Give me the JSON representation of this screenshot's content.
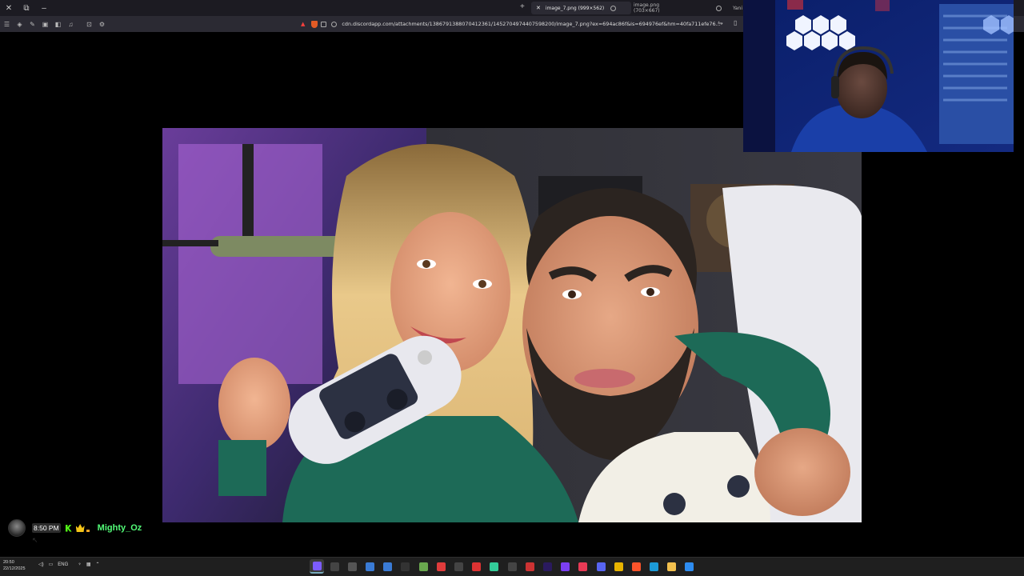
{
  "browser": {
    "tabs": [
      {
        "label": "image_7.png (999×562)",
        "active": true
      },
      {
        "label": "image.png (703×667)",
        "active": false
      },
      {
        "label": "Yani",
        "active": false
      }
    ],
    "url": "cdn.discordapp.com/attachments/1386791388070412361/1452704974407598200/image_7.png?ex=694ac86f&is=694976ef&hm=40fa711efe76..."
  },
  "chat": {
    "time": "8:50 PM",
    "username": "Mighty_Oz"
  },
  "taskbar": {
    "clock_time": "20:50",
    "clock_date": "22/12/2025",
    "language": "ENG",
    "apps": [
      {
        "name": "browser-pen-app",
        "color": "#7c5cff",
        "active": true
      },
      {
        "name": "audio-app",
        "color": "#444"
      },
      {
        "name": "obs-app",
        "color": "#555"
      },
      {
        "name": "arrow-app",
        "color": "#3a7bd5"
      },
      {
        "name": "arrow2-app",
        "color": "#3a7bd5"
      },
      {
        "name": "steam-app",
        "color": "#333"
      },
      {
        "name": "minecraft-app",
        "color": "#6aa84f"
      },
      {
        "name": "davinci-app",
        "color": "#e03c3c"
      },
      {
        "name": "menu-app",
        "color": "#444"
      },
      {
        "name": "red-app",
        "color": "#d33"
      },
      {
        "name": "grid-app",
        "color": "#3c9"
      },
      {
        "name": "openai-app",
        "color": "#444"
      },
      {
        "name": "chrome-red-app",
        "color": "#c33"
      },
      {
        "name": "premiere-app",
        "color": "#2a1a5e"
      },
      {
        "name": "purple-app",
        "color": "#7b3ff2"
      },
      {
        "name": "music-app",
        "color": "#e93a55"
      },
      {
        "name": "discord-app",
        "color": "#5865f2"
      },
      {
        "name": "chrome-app",
        "color": "#e8b400"
      },
      {
        "name": "brave-app",
        "color": "#fb542b"
      },
      {
        "name": "edge-app",
        "color": "#1c9bd8"
      },
      {
        "name": "folder-app",
        "color": "#f2c04e"
      },
      {
        "name": "store-app",
        "color": "#2d8cf0"
      }
    ]
  },
  "colors": {
    "username": "#53fc78",
    "kick_badge": "#53fc18",
    "crown_badge": "#f5c518",
    "browser_bg": "#1c1b22"
  }
}
